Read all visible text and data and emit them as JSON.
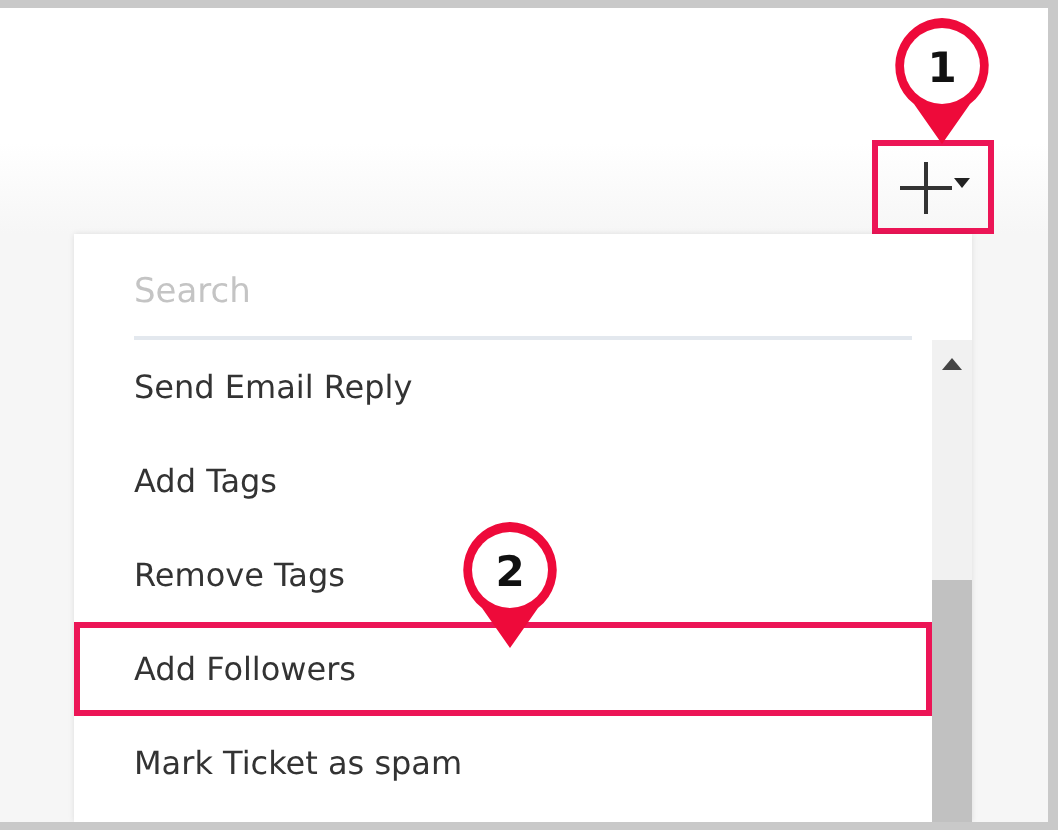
{
  "add_button": {
    "highlighted": true
  },
  "search": {
    "placeholder": "Search"
  },
  "menu_items": [
    {
      "label": "Send Email Reply",
      "highlighted": false
    },
    {
      "label": "Add Tags",
      "highlighted": false
    },
    {
      "label": "Remove Tags",
      "highlighted": false
    },
    {
      "label": "Add Followers",
      "highlighted": true
    },
    {
      "label": "Mark Ticket as spam",
      "highlighted": false
    }
  ],
  "callouts": [
    {
      "label": "1"
    },
    {
      "label": "2"
    }
  ]
}
